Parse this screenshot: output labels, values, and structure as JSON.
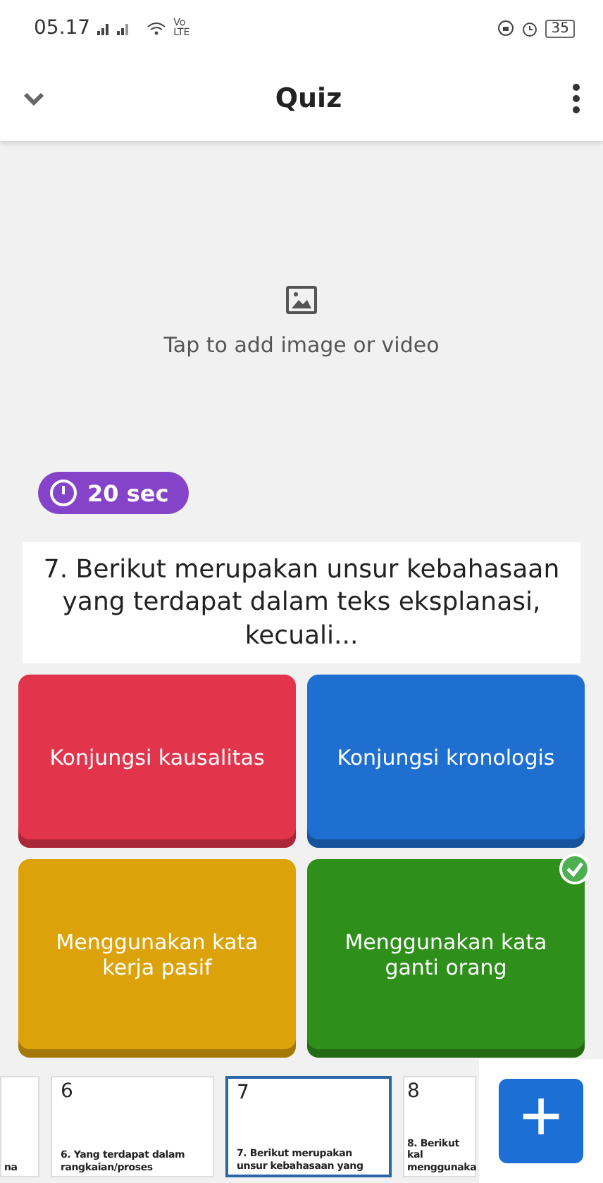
{
  "status_bar": {
    "time": "05.17",
    "network": "Vo LTE",
    "battery": "35"
  },
  "header": {
    "title": "Quiz"
  },
  "media": {
    "prompt": "Tap to add image or video"
  },
  "timer": {
    "label": "20 sec"
  },
  "question": {
    "text": "7. Berikut merupakan unsur kebahasaan yang terdapat dalam teks eksplanasi, kecuali..."
  },
  "options": [
    {
      "text": "Konjungsi kausalitas",
      "color": "#e2344b",
      "correct": false
    },
    {
      "text": "Konjungsi kronologis",
      "color": "#1f6fd0",
      "correct": false
    },
    {
      "text": "Menggunakan kata kerja pasif",
      "color": "#dca20a",
      "correct": false
    },
    {
      "text": "Menggunakan kata ganti orang",
      "color": "#2e8f1a",
      "correct": true
    }
  ],
  "slides": [
    {
      "text": "na",
      "selected": false
    },
    {
      "number": "6",
      "text": "6. Yang terdapat dalam rangkaian/proses",
      "selected": false
    },
    {
      "number": "7",
      "text": "7. Berikut merupakan unsur kebahasaan yang",
      "selected": true
    },
    {
      "number": "8",
      "text": "8. Berikut kal menggunaka",
      "selected": false
    }
  ],
  "add_button": {
    "label": "+"
  }
}
